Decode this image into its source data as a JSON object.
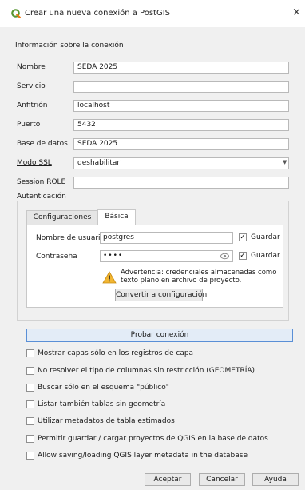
{
  "window": {
    "title": "Crear una nueva conexión a PostGIS",
    "close_glyph": "×",
    "logo_icon": "qgis-logo-icon",
    "accent_color": "#589632"
  },
  "info_section": {
    "label": "Información sobre la conexión"
  },
  "fields": {
    "nombre": {
      "label": "Nombre",
      "value": "SEDA 2025"
    },
    "servicio": {
      "label": "Servicio",
      "value": ""
    },
    "anfitrion": {
      "label": "Anfitrión",
      "value": "localhost"
    },
    "puerto": {
      "label": "Puerto",
      "value": "5432"
    },
    "base_datos": {
      "label": "Base de datos",
      "value": "SEDA 2025"
    },
    "modo_ssl": {
      "label": "Modo SSL",
      "value": "deshabilitar"
    },
    "session_role": {
      "label": "Session ROLE",
      "value": ""
    }
  },
  "auth": {
    "label": "Autenticación",
    "tabs": [
      {
        "label": "Configuraciones",
        "active": false
      },
      {
        "label": "Básica",
        "active": true
      }
    ],
    "username": {
      "label": "Nombre de usuario",
      "value": "postgres",
      "save_checked": true,
      "save_label": "Guardar"
    },
    "password": {
      "label": "Contraseña",
      "value": "••••",
      "save_checked": true,
      "save_label": "Guardar"
    },
    "warning": {
      "text_line1": "Advertencia: credenciales almacenadas como",
      "text_line2": "texto plano en archivo de proyecto.",
      "icon": "warning-icon"
    },
    "convert_button": "Convertir a configuración"
  },
  "test_button": "Probar conexión",
  "options": [
    {
      "label": "Mostrar capas sólo en los registros de capa",
      "checked": false
    },
    {
      "label": "No resolver el tipo de columnas sin restricción (GEOMETRÍA)",
      "checked": false
    },
    {
      "label": "Buscar sólo en el esquema \"público\"",
      "checked": false
    },
    {
      "label": "Listar también tablas sin geometría",
      "checked": false
    },
    {
      "label": "Utilizar metadatos de tabla estimados",
      "checked": false
    },
    {
      "label": "Permitir guardar / cargar proyectos de QGIS en la base de datos",
      "checked": false
    },
    {
      "label": "Allow saving/loading QGIS layer metadata in the database",
      "checked": false
    }
  ],
  "buttons": {
    "accept": "Aceptar",
    "cancel": "Cancelar",
    "help": "Ayuda"
  }
}
